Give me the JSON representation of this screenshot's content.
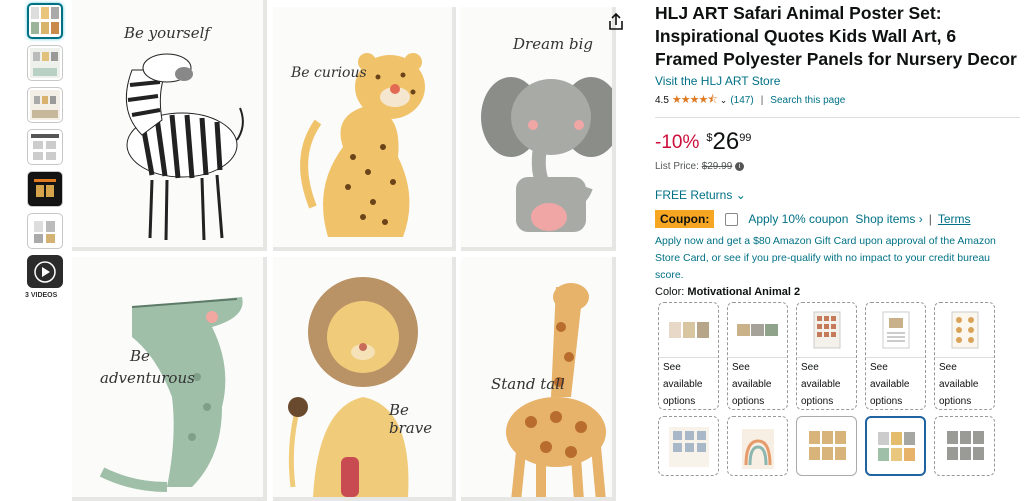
{
  "product": {
    "title": "HLJ ART Safari Animal Poster Set: Inspirational Quotes Kids Wall Art, 6 Framed Polyester Panels for Nursery Decor",
    "store_link": "Visit the HLJ ART Store",
    "rating_value": "4.5",
    "rating_count": "(147)",
    "search_link": "Search this page"
  },
  "pricing": {
    "discount": "-10%",
    "currency": "$",
    "whole": "26",
    "fraction": "99",
    "list_label": "List Price:",
    "list_price": "$29.99"
  },
  "returns": {
    "label": "FREE Returns"
  },
  "coupon": {
    "badge": "Coupon:",
    "apply_text": "Apply 10% coupon",
    "shop_items": "Shop items ›",
    "separator": "|",
    "terms": "Terms"
  },
  "credit_offer": "Apply now and get a $80 Amazon Gift Card upon approval of the Amazon Store Card, or see if you pre-qualify with no impact to your credit bureau score.",
  "color": {
    "label": "Color:",
    "value": "Motivational Animal 2"
  },
  "swatches": [
    {
      "line1": "See",
      "line2": "available",
      "line3": "options"
    },
    {
      "line1": "See",
      "line2": "available",
      "line3": "options"
    },
    {
      "line1": "See",
      "line2": "available",
      "line3": "options"
    },
    {
      "line1": "See",
      "line2": "available",
      "line3": "options"
    },
    {
      "line1": "See",
      "line2": "available",
      "line3": "options"
    }
  ],
  "videos_label": "3 VIDEOS",
  "panels": [
    {
      "quote": "Be yourself",
      "animal": "zebra"
    },
    {
      "quote": "Be curious",
      "animal": "leopard"
    },
    {
      "quote": "Dream big",
      "animal": "elephant"
    },
    {
      "quote_line1": "Be",
      "quote_line2": "adventurous",
      "animal": "crocodile"
    },
    {
      "quote": "Be brave",
      "animal": "lion"
    },
    {
      "quote": "Stand tall",
      "animal": "giraffe"
    }
  ],
  "colors": {
    "link": "#007185",
    "discount": "#cc0c39",
    "coupon": "#f7a622",
    "star": "#de7921"
  }
}
